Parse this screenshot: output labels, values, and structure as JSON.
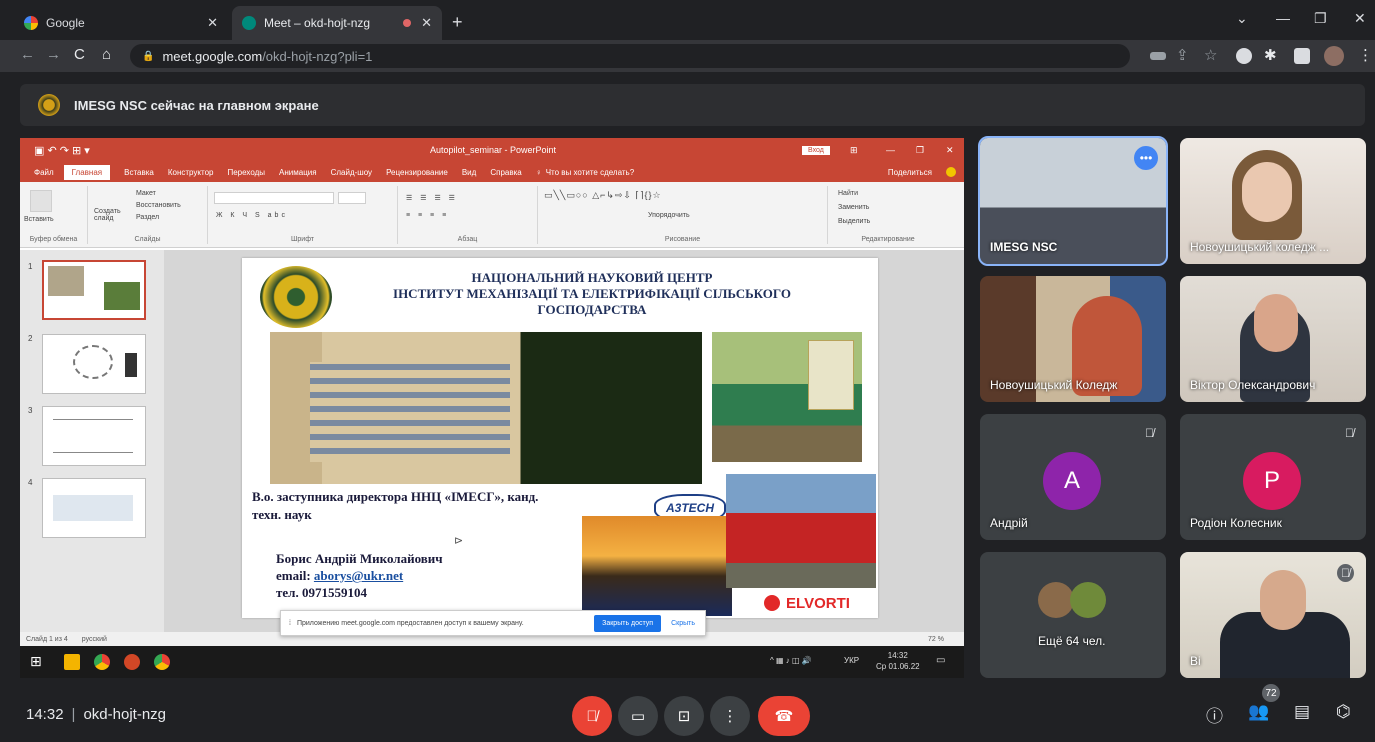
{
  "browser": {
    "tabs": [
      {
        "title": "Google",
        "active": false
      },
      {
        "title": "Meet – okd-hojt-nzg",
        "active": true
      }
    ],
    "url_host": "meet.google.com",
    "url_path": "/okd-hojt-nzg?pli=1"
  },
  "banner": {
    "text": "IMESG NSC сейчас на главном экране"
  },
  "powerpoint": {
    "window_title": "Autopilot_seminar - PowerPoint",
    "login": "Вход",
    "share": "Поделиться",
    "menu": [
      "Файл",
      "Главная",
      "Вставка",
      "Конструктор",
      "Переходы",
      "Анимация",
      "Слайд-шоу",
      "Рецензирование",
      "Вид",
      "Справка",
      "Что вы хотите сделать?"
    ],
    "ribbon_groups": [
      "Буфер обмена",
      "Слайды",
      "Шрифт",
      "Абзац",
      "Рисование",
      "Редактирование"
    ],
    "ribbon_items": {
      "paste": "Вставить",
      "layout": "Макет",
      "restore": "Восстановить",
      "new_slide": "Создать слайд",
      "section": "Раздел",
      "arrange": "Упорядочить",
      "find": "Найти",
      "replace": "Заменить",
      "select": "Выделить"
    },
    "slide_numbers": [
      "1",
      "2",
      "3",
      "4"
    ],
    "status": {
      "slide": "Слайд 1 из 4",
      "lang": "русский",
      "zoom": "72 %"
    },
    "taskbar_time": "14:32",
    "taskbar_date": "Ср 01.06.22",
    "taskbar_lang": "УКР"
  },
  "slide": {
    "title_lines": [
      "НАЦІОНАЛЬНИЙ НАУКОВИЙ ЦЕНТР",
      "ІНСТИТУТ МЕХАНІЗАЦІЇ ТА ЕЛЕКТРИФІКАЦІЇ СІЛЬСЬКОГО",
      "ГОСПОДАРСТВА"
    ],
    "position_line1": "В.о. заступника директора ННЦ «ІМЕСГ», канд.",
    "position_line2": "техн. наук",
    "name": "Борис Андрій Миколайович",
    "email_label": "email:",
    "email": "aborys@ukr.net",
    "phone_label": "тел.",
    "phone": "0971559104",
    "logo_a3tech": "A3TECH",
    "logo_elvorti": "ELVORTI"
  },
  "share_notice": {
    "text": "Приложению meet.google.com предоставлен доступ к вашему экрану.",
    "stop": "Закрыть доступ",
    "hide": "Скрыть"
  },
  "participants": [
    {
      "name": "IMESG NSC"
    },
    {
      "name": "Новоушицький коледж ..."
    },
    {
      "name": "Новоушицький Коледж"
    },
    {
      "name": "Віктор Олександрович"
    },
    {
      "name": "Андрій",
      "initial": "A",
      "color": "#8e24aa"
    },
    {
      "name": "Родіон Колесник",
      "initial": "P",
      "color": "#d81b60"
    },
    {
      "name": "Ещё 64 чел."
    },
    {
      "name": "Ві"
    }
  ],
  "meeting": {
    "time": "14:32",
    "code": "okd-hojt-nzg",
    "participants_count": "72"
  }
}
